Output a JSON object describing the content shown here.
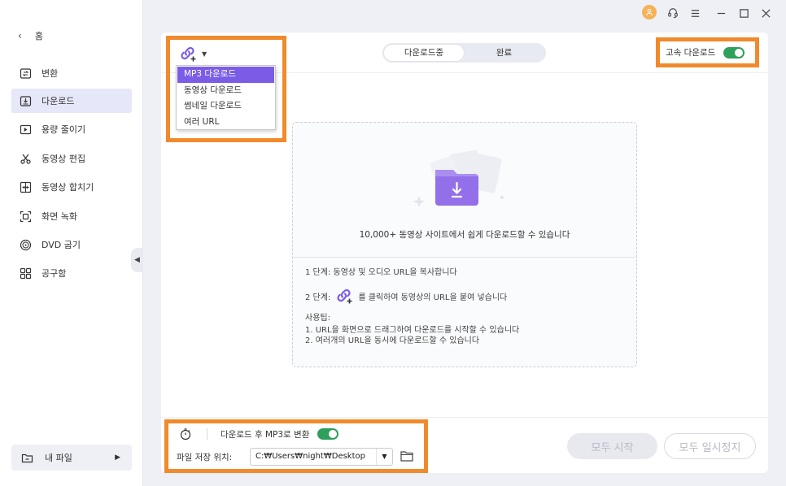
{
  "sidebar": {
    "home_label": "홈",
    "items": [
      {
        "label": "변환",
        "icon": "convert-icon"
      },
      {
        "label": "다운로드",
        "icon": "download-icon",
        "active": true
      },
      {
        "label": "용량 줄이기",
        "icon": "compress-icon"
      },
      {
        "label": "동영상 편집",
        "icon": "scissors-icon"
      },
      {
        "label": "동영상 합치기",
        "icon": "merge-icon"
      },
      {
        "label": "화면 녹화",
        "icon": "screen-record-icon"
      },
      {
        "label": "DVD 굽기",
        "icon": "disc-icon"
      },
      {
        "label": "공구함",
        "icon": "toolbox-icon"
      }
    ],
    "my_files_label": "내 파일"
  },
  "toolbar": {
    "tabs": [
      "다운로드중",
      "완료"
    ],
    "active_tab": "다운로드중",
    "speed_label": "고속 다운로드",
    "speed_enabled": true,
    "link_dropdown_options": [
      "MP3 다운로드",
      "동영상 다운로드",
      "썸네일 다운로드",
      "여러 URL"
    ],
    "link_dropdown_selected": "MP3 다운로드"
  },
  "dropzone": {
    "headline": "10,000+ 동영상 사이트에서 쉽게 다운로드할 수 있습니다",
    "step1": "1 단계: 동영상 및 오디오 URL을 복사합니다",
    "step2_prefix": "2 단계:",
    "step2_suffix": "를 클릭하여 동영상의 URL을 붙여 넣습니다",
    "tips_title": "사용팁:",
    "tip1": "1. URL을 화면으로 드래그하여 다운로드를 시작할 수 있습니다",
    "tip2": "2. 여러개의 URL을 동시에 다운로드할 수 있습니다"
  },
  "bottom": {
    "mp3_convert_label": "다운로드 후 MP3로 변환",
    "mp3_convert_enabled": true,
    "save_location_label": "파일 저장 위치:",
    "save_path": "C:₩Users₩night₩Desktop",
    "start_all_label": "모두 시작",
    "pause_all_label": "모두 일시정지"
  },
  "colors": {
    "accent": "#7b5ce6",
    "highlight": "#f08a2c",
    "toggle_on": "#2ea05c",
    "avatar": "#f6b25a"
  }
}
